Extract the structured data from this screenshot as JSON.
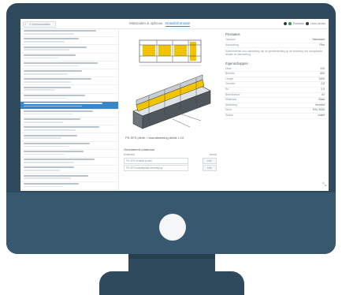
{
  "topbar": {
    "search_text": "≡ Zoekresultaten",
    "tabs": [
      {
        "label": "Materialen & opbouw",
        "active": false
      },
      {
        "label": "Detailinformatie",
        "active": true
      }
    ],
    "status": {
      "label_1": "Prestatie",
      "label_2": "Lees verder"
    },
    "colors": {
      "accent": "#3a86c8",
      "dot_1": "#2b3e4c",
      "dot_2": "#2d9b4e",
      "dot_3": "#2b3e4c"
    }
  },
  "list": {
    "count": 22,
    "selected_index": 9
  },
  "drawing": {
    "caption": "PS-SFS plinth / muurafwerking detail 1:10",
    "colors": {
      "insulation": "#f2c400",
      "steel": "#8c9399",
      "outline": "#333b41"
    }
  },
  "related": {
    "title": "Gerelateerd materiaal",
    "column_left": "Materiaal",
    "column_right": "Aantal",
    "rows": [
      {
        "name": "PS-SFS detailkit profiel",
        "button": "Info"
      },
      {
        "name": "PS-SFS isolatieplaat bevestiging",
        "button": "Info"
      }
    ]
  },
  "details": {
    "section_1": "Prestaties",
    "section_2": "Eigenschappen",
    "props_1": [
      {
        "k": "Opbouw",
        "v": "Standaard"
      },
      {
        "k": "Aansluiting",
        "v": "Plint"
      }
    ],
    "description": "Systeemdetail voor aansluiting van de gevelbekleding op de fundering met doorgaande isolatie en waterkering.",
    "props_2": [
      {
        "k": "Dikte",
        "v": "120"
      },
      {
        "k": "Breedte",
        "v": "600"
      },
      {
        "k": "Lengte",
        "v": "2400"
      },
      {
        "k": "Gewicht",
        "v": "4,8"
      },
      {
        "k": "Rc",
        "v": "3,5"
      },
      {
        "k": "Brandklasse",
        "v": "A2"
      },
      {
        "k": "Materiaal",
        "v": "Staal"
      },
      {
        "k": "Afwerking",
        "v": "Verzinkt"
      },
      {
        "k": "Kleur",
        "v": "RAL 9006"
      },
      {
        "k": "Status",
        "v": "Actief"
      }
    ],
    "corner_icon": "resize-icon"
  }
}
